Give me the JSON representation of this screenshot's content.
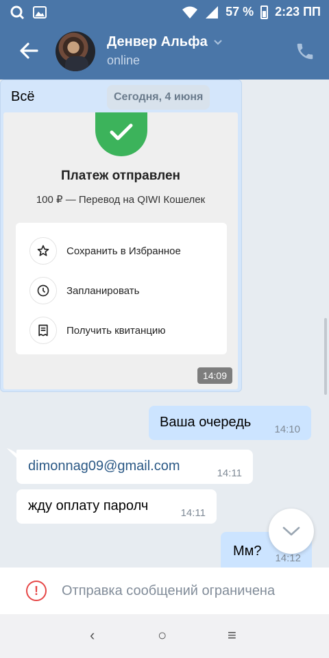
{
  "status_bar": {
    "battery": "57 %",
    "time": "2:23 ПП"
  },
  "header": {
    "name": "Денвер Альфа",
    "status": "online"
  },
  "date_separator": "Сегодня, 4 июня",
  "messages": [
    {
      "dir": "out",
      "text": "Всё",
      "time": "14:09",
      "payment": {
        "title": "Платеж отправлен",
        "subtitle": "100 ₽ — Перевод на QIWI Кошелек",
        "actions": [
          "Сохранить в Избранное",
          "Запланировать",
          "Получить квитанцию"
        ]
      }
    },
    {
      "dir": "out",
      "text": "Ваша очередь",
      "time": "14:10"
    },
    {
      "dir": "in",
      "text": "dimonnag09@gmail.com",
      "time": "14:11"
    },
    {
      "dir": "in",
      "text": "жду оплату паролч",
      "time": "14:11"
    },
    {
      "dir": "out",
      "text": "Мм?",
      "time": "14:12"
    }
  ],
  "restriction": {
    "text": "Отправка сообщений ограничена",
    "icon": "!"
  },
  "nav": {
    "back": "‹",
    "home": "○",
    "menu": "≡"
  },
  "colors": {
    "header": "#4a76a8",
    "outgoing": "#cce4ff",
    "link": "#2a5885",
    "check": "#3cb35b"
  }
}
